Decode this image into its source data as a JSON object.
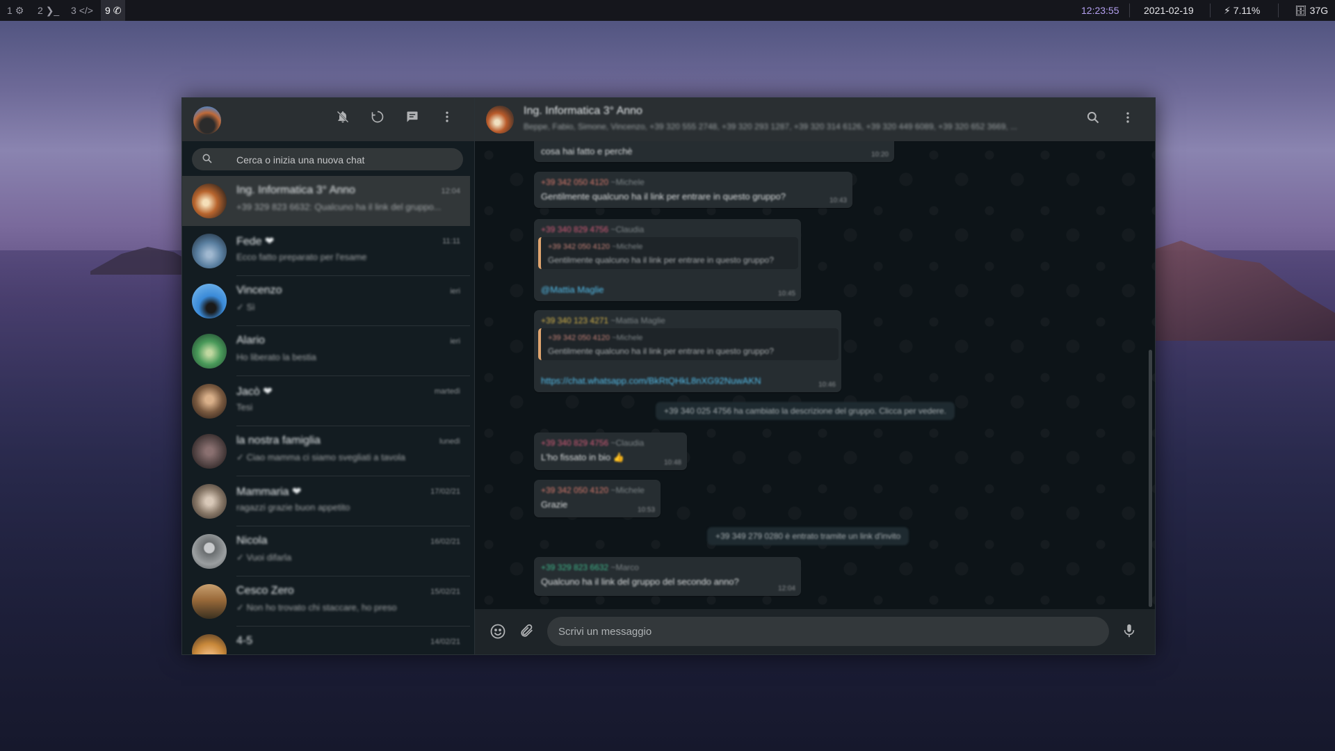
{
  "topbar": {
    "workspaces": [
      {
        "num": "1",
        "icon": "gear-icon",
        "glyph": "⚙"
      },
      {
        "num": "2",
        "icon": "terminal-icon",
        "glyph": "❯_"
      },
      {
        "num": "3",
        "icon": "code-icon",
        "glyph": "</>"
      },
      {
        "num": "9",
        "icon": "whatsapp-icon",
        "glyph": "✆"
      }
    ],
    "time": "12:23:55",
    "date": "2021-02-19",
    "battery": "⚡ 7.11%",
    "storage": "🗄 37G",
    "colors": {
      "time": "#b4a0f0",
      "bar": "#15161c"
    }
  },
  "sidebar": {
    "search_placeholder": "Cerca o inizia una nuova chat",
    "chats": [
      {
        "name": "Ing. Informatica 3° Anno",
        "preview": "+39 329 823 6632: Qualcuno ha il link del gruppo...",
        "time": "12:04",
        "badge": "",
        "avatar_color": "#b8652e",
        "selected": true
      },
      {
        "name": "Fede ❤",
        "preview": "Ecco fatto preparato per l'esame",
        "time": "11:11",
        "avatar_color": "#5a7fa0"
      },
      {
        "name": "Vincenzo",
        "preview": "✓ Sì",
        "time": "ieri",
        "avatar_color": "#3a8ad8"
      },
      {
        "name": "Alario",
        "preview": "Ho liberato la bestia",
        "time": "ieri",
        "avatar_color": "#4a9a5a"
      },
      {
        "name": "Jacò ❤",
        "preview": "Tesi",
        "time": "martedì",
        "avatar_color": "#7a5a40"
      },
      {
        "name": "la nostra famiglia",
        "preview": "✓ Ciao mamma ci siamo svegliati a tavola",
        "time": "lunedì",
        "avatar_color": "#5a4a4a"
      },
      {
        "name": "Mammaria ❤",
        "preview": "ragazzi grazie buon appetito",
        "time": "17/02/21",
        "avatar_color": "#8a7a6a"
      },
      {
        "name": "Nicola",
        "preview": "✓ Vuoi difarla",
        "time": "16/02/21",
        "avatar_color": "#6a6e70"
      },
      {
        "name": "Cesco Zero",
        "preview": "✓ Non ho trovato chi staccare, ho preso",
        "time": "15/02/21",
        "avatar_color": "#9a6a3a"
      },
      {
        "name": "4-5",
        "preview": "",
        "time": "14/02/21",
        "avatar_color": "#c8883a"
      }
    ]
  },
  "conversation": {
    "title": "Ing. Informatica 3° Anno",
    "subtitle": "Beppe, Fabio, Simone, Vincenzo, +39 320 555 2748, +39 320 293 1287, +39 320 314 6126, +39 320 449 6089, +39 320 652 3669, ...",
    "messages": [
      {
        "kind": "text",
        "sender": "",
        "alias": "",
        "text": "cosa hai fatto e perchè",
        "time": "10:20"
      },
      {
        "kind": "text",
        "sender": "+39 342 050 4120",
        "alias": "~Michele",
        "sender_color": "#d97a6c",
        "text": "Gentilmente qualcuno ha il link per entrare in questo gruppo?",
        "time": "10:43"
      },
      {
        "kind": "quote",
        "sender": "+39 340 829 4756",
        "alias": "~Claudia",
        "sender_color": "#d35b78",
        "quote_sender": "+39 342 050 4120",
        "quote_alias": "~Michele",
        "quote_text": "Gentilmente qualcuno ha il link per entrare in questo gruppo?",
        "text": "@Mattia Maglie",
        "time": "10:45"
      },
      {
        "kind": "quote",
        "sender": "+39 340 123 4271",
        "alias": "~Mattia Maglie",
        "sender_color": "#d6b44a",
        "quote_sender": "+39 342 050 4120",
        "quote_alias": "~Michele",
        "quote_text": "Gentilmente qualcuno ha il link per entrare in questo gruppo?",
        "text": "https://chat.whatsapp.com/BkRtQHkL8nXG92NuwAKN",
        "time": "10:46"
      },
      {
        "kind": "system",
        "text": "+39 340 025 4756 ha cambiato la descrizione del gruppo. Clicca per vedere."
      },
      {
        "kind": "text",
        "sender": "+39 340 829 4756",
        "alias": "~Claudia",
        "sender_color": "#d35b78",
        "text": "L'ho fissato in bio 👍",
        "time": "10:48"
      },
      {
        "kind": "text",
        "sender": "+39 342 050 4120",
        "alias": "~Michele",
        "sender_color": "#d97a6c",
        "text": "Grazie",
        "time": "10:53"
      },
      {
        "kind": "system",
        "text": "+39 349 279 0280 è entrato tramite un link d'invito"
      },
      {
        "kind": "text",
        "sender": "+39 329 823 6632",
        "alias": "~Marco",
        "sender_color": "#3fb68a",
        "text": "Qualcuno ha il link del gruppo del secondo anno?",
        "time": "12:04"
      }
    ],
    "composer_placeholder": "Scrivi un messaggio"
  }
}
